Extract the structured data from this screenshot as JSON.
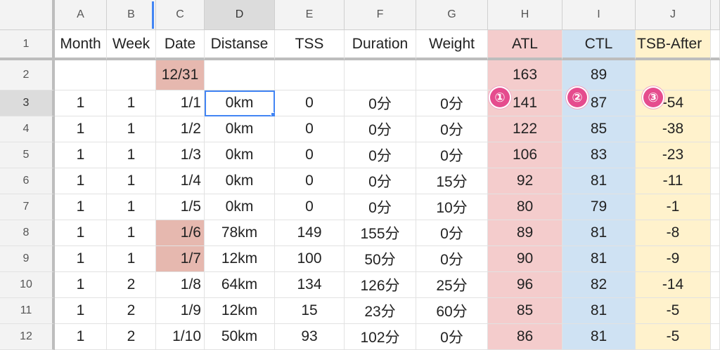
{
  "column_headers": [
    "A",
    "B",
    "C",
    "D",
    "E",
    "F",
    "G",
    "H",
    "I",
    "J"
  ],
  "row_numbers": [
    "1",
    "2",
    "3",
    "4",
    "5",
    "6",
    "7",
    "8",
    "9",
    "10",
    "11",
    "12"
  ],
  "header_row": [
    "Month",
    "Week",
    "Date",
    "Distanse",
    "TSS",
    "Duration",
    "Weight",
    "ATL",
    "CTL",
    "TSB-After"
  ],
  "row2": {
    "date": "12/31",
    "atl": "163",
    "ctl": "89"
  },
  "rows": [
    {
      "month": "1",
      "week": "1",
      "date": "1/1",
      "distance": "0km",
      "tss": "0",
      "duration": "0分",
      "weight": "0分",
      "atl": "141",
      "ctl": "87",
      "tsb": "-54"
    },
    {
      "month": "1",
      "week": "1",
      "date": "1/2",
      "distance": "0km",
      "tss": "0",
      "duration": "0分",
      "weight": "0分",
      "atl": "122",
      "ctl": "85",
      "tsb": "-38"
    },
    {
      "month": "1",
      "week": "1",
      "date": "1/3",
      "distance": "0km",
      "tss": "0",
      "duration": "0分",
      "weight": "0分",
      "atl": "106",
      "ctl": "83",
      "tsb": "-23"
    },
    {
      "month": "1",
      "week": "1",
      "date": "1/4",
      "distance": "0km",
      "tss": "0",
      "duration": "0分",
      "weight": "15分",
      "atl": "92",
      "ctl": "81",
      "tsb": "-11"
    },
    {
      "month": "1",
      "week": "1",
      "date": "1/5",
      "distance": "0km",
      "tss": "0",
      "duration": "0分",
      "weight": "10分",
      "atl": "80",
      "ctl": "79",
      "tsb": "-1"
    },
    {
      "month": "1",
      "week": "1",
      "date": "1/6",
      "distance": "78km",
      "tss": "149",
      "duration": "155分",
      "weight": "0分",
      "atl": "89",
      "ctl": "81",
      "tsb": "-8"
    },
    {
      "month": "1",
      "week": "1",
      "date": "1/7",
      "distance": "12km",
      "tss": "100",
      "duration": "50分",
      "weight": "0分",
      "atl": "90",
      "ctl": "81",
      "tsb": "-9"
    },
    {
      "month": "1",
      "week": "2",
      "date": "1/8",
      "distance": "64km",
      "tss": "134",
      "duration": "126分",
      "weight": "25分",
      "atl": "96",
      "ctl": "82",
      "tsb": "-14"
    },
    {
      "month": "1",
      "week": "2",
      "date": "1/9",
      "distance": "12km",
      "tss": "15",
      "duration": "23分",
      "weight": "60分",
      "atl": "85",
      "ctl": "81",
      "tsb": "-5"
    },
    {
      "month": "1",
      "week": "2",
      "date": "1/10",
      "distance": "50km",
      "tss": "93",
      "duration": "102分",
      "weight": "0分",
      "atl": "86",
      "ctl": "81",
      "tsb": "-5"
    }
  ],
  "markers": [
    "①",
    "②",
    "③"
  ],
  "colors": {
    "atl": "#f4cccc",
    "ctl": "#cfe2f3",
    "tsb": "#fff2cc",
    "highlight": "#e6b8af",
    "selection": "#4285f4",
    "marker": "#e54c8e"
  }
}
